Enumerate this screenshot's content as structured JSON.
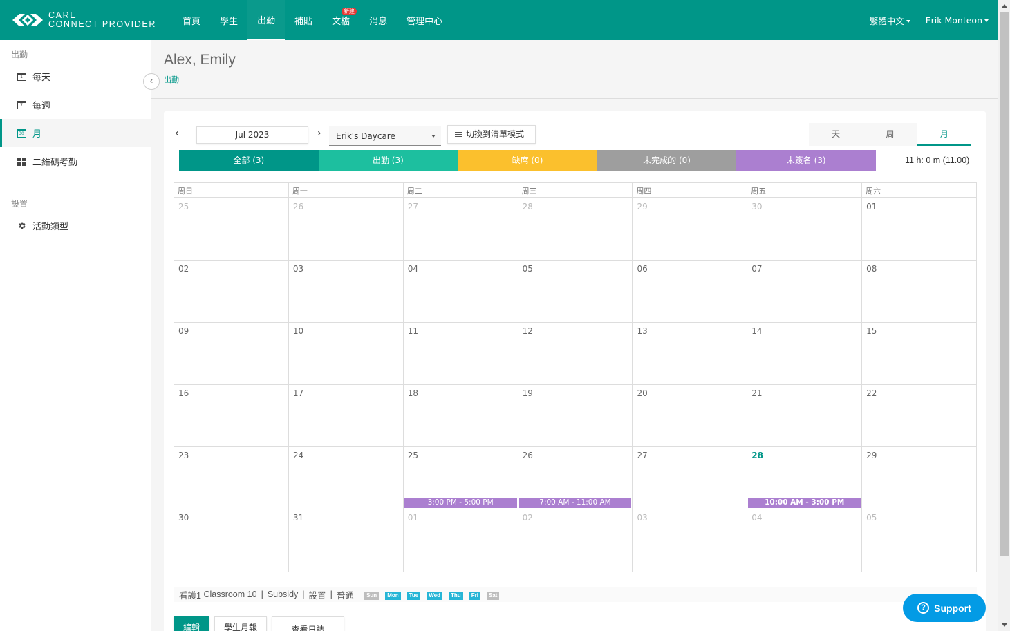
{
  "logo": {
    "line1": "CARE",
    "line2": "CONNECT PROVIDER"
  },
  "nav": [
    {
      "label": "首頁"
    },
    {
      "label": "學生"
    },
    {
      "label": "出勤"
    },
    {
      "label": "補貼"
    },
    {
      "label": "文檔",
      "badge": "新建"
    },
    {
      "label": "消息"
    },
    {
      "label": "管理中心"
    }
  ],
  "header_right": {
    "language": "繁體中文",
    "user": "Erik Monteon"
  },
  "sidebar": {
    "section1": "出勤",
    "items": [
      {
        "label": "每天",
        "icon_num": "1"
      },
      {
        "label": "每週",
        "icon_num": "7"
      },
      {
        "label": "月",
        "icon_num": "30"
      },
      {
        "label": "二維碼考勤"
      }
    ],
    "section2": "設置",
    "settings_items": [
      {
        "label": "活動類型"
      }
    ]
  },
  "page": {
    "title": "Alex, Emily",
    "breadcrumb": "出勤"
  },
  "toolbar": {
    "prev": "‹",
    "next": "›",
    "month": "Jul 2023",
    "location": "Erik's Daycare",
    "list_mode": "切換到清單模式",
    "view_tabs": [
      "天",
      "周",
      "月"
    ]
  },
  "statuses": [
    {
      "label": "全部 (3)",
      "color": "#009688"
    },
    {
      "label": "出勤 (3)",
      "color": "#1dbf9f"
    },
    {
      "label": "缺席 (0)",
      "color": "#fbc02d"
    },
    {
      "label": "未完成的 (0)",
      "color": "#9e9e9e"
    },
    {
      "label": "未簽名 (3)",
      "color": "#ab7fd0"
    }
  ],
  "total_hours": "11 h: 0 m (11.00)",
  "calendar": {
    "weekdays": [
      "周日",
      "周一",
      "周二",
      "周三",
      "周四",
      "周五",
      "周六"
    ],
    "weeks": [
      [
        {
          "d": "25",
          "o": true
        },
        {
          "d": "26",
          "o": true
        },
        {
          "d": "27",
          "o": true
        },
        {
          "d": "28",
          "o": true
        },
        {
          "d": "29",
          "o": true
        },
        {
          "d": "30",
          "o": true
        },
        {
          "d": "01"
        }
      ],
      [
        {
          "d": "02"
        },
        {
          "d": "03"
        },
        {
          "d": "04"
        },
        {
          "d": "05"
        },
        {
          "d": "06"
        },
        {
          "d": "07"
        },
        {
          "d": "08"
        }
      ],
      [
        {
          "d": "09"
        },
        {
          "d": "10"
        },
        {
          "d": "11"
        },
        {
          "d": "12"
        },
        {
          "d": "13"
        },
        {
          "d": "14"
        },
        {
          "d": "15"
        }
      ],
      [
        {
          "d": "16"
        },
        {
          "d": "17"
        },
        {
          "d": "18"
        },
        {
          "d": "19"
        },
        {
          "d": "20"
        },
        {
          "d": "21"
        },
        {
          "d": "22"
        }
      ],
      [
        {
          "d": "23"
        },
        {
          "d": "24"
        },
        {
          "d": "25",
          "e": "3:00 PM - 5:00 PM"
        },
        {
          "d": "26",
          "e": "7:00 AM - 11:00 AM"
        },
        {
          "d": "27"
        },
        {
          "d": "28",
          "t": true,
          "e": "10:00 AM - 3:00 PM"
        },
        {
          "d": "29"
        }
      ],
      [
        {
          "d": "30"
        },
        {
          "d": "31"
        },
        {
          "d": "01",
          "o": true
        },
        {
          "d": "02",
          "o": true
        },
        {
          "d": "03",
          "o": true
        },
        {
          "d": "04",
          "o": true
        },
        {
          "d": "05",
          "o": true
        }
      ]
    ]
  },
  "legend": {
    "care": "看護1",
    "classroom": "Classroom 10",
    "subsidy": "Subsidy",
    "settings": "設置",
    "normal": "普通",
    "days": [
      {
        "label": "Sun",
        "color": "#bdbdbd"
      },
      {
        "label": "Mon",
        "color": "#26b5d6"
      },
      {
        "label": "Tue",
        "color": "#26b5d6"
      },
      {
        "label": "Wed",
        "color": "#26b5d6"
      },
      {
        "label": "Thu",
        "color": "#26b5d6"
      },
      {
        "label": "Fri",
        "color": "#26b5d6"
      },
      {
        "label": "Sat",
        "color": "#bdbdbd"
      }
    ]
  },
  "bottom_buttons": [
    "編輯",
    "學生月報",
    "查看日誌"
  ],
  "support": {
    "label": "Support"
  },
  "colors": {
    "primary": "#009688",
    "event": "#ab7fd0"
  }
}
